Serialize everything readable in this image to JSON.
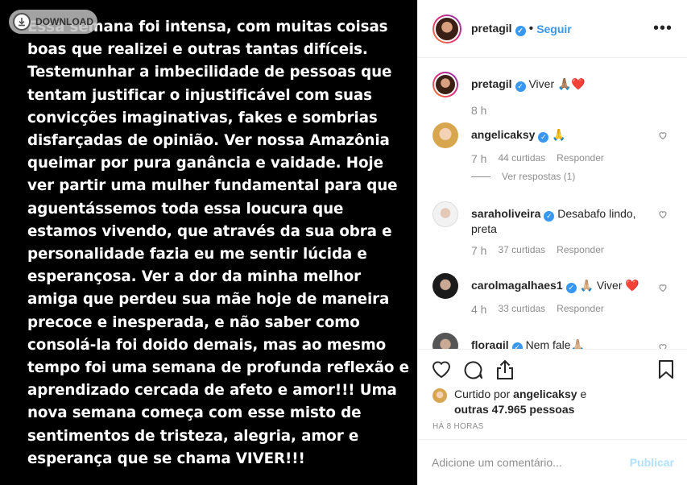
{
  "post": {
    "text": "Essa semana foi intensa, com muitas coisas boas que realizei e outras tantas difíceis. Testemunhar a imbecilidade de pessoas que tentam justificar o injustificável com suas convicções imaginativas, fakes e sombrias disfarçadas de opinião. Ver nossa Amazônia queimar por pura ganância e vaidade. Hoje ver partir uma mulher fundamental para que aguentássemos toda essa loucura que estamos vivendo, que através da sua obra e personalidade fazia eu me sentir lúcida e esperançosa. Ver a dor da minha melhor amiga que perdeu sua mãe hoje de maneira precoce e inesperada, e não saber como consolá-la foi doido demais, mas ao mesmo tempo foi uma semana de profunda reflexão e aprendizado cercada de afeto e amor!!! Uma nova semana começa com esse misto de sentimentos de tristeza, alegria, amor e esperança que se chama VIVER!!!"
  },
  "download": {
    "label": "DOWNLOAD"
  },
  "header": {
    "username": "pretagil",
    "separator": "•",
    "follow_label": "Seguir",
    "more_label": "•••"
  },
  "caption": {
    "username": "pretagil",
    "text": "Viver 🙏🏽❤️",
    "time": "8 h"
  },
  "comments": [
    {
      "username": "angelicaksy",
      "text": "🙏",
      "time": "7 h",
      "likes": "44 curtidas",
      "reply_label": "Responder",
      "view_replies": "Ver respostas (1)"
    },
    {
      "username": "saraholiveira",
      "text": "Desabafo lindo, preta",
      "time": "7 h",
      "likes": "37 curtidas",
      "reply_label": "Responder"
    },
    {
      "username": "carolmagalhaes1",
      "text": "🙏🏼 Viver ❤️",
      "time": "4 h",
      "likes": "33 curtidas",
      "reply_label": "Responder"
    },
    {
      "username": "floragil",
      "text": "Nem fale🙏🏼"
    }
  ],
  "likes": {
    "prefix": "Curtido por",
    "user": "angelicaksy",
    "middle": "e",
    "others": "outras 47.965 pessoas"
  },
  "time_ago": "HÁ 8 HORAS",
  "comment_box": {
    "placeholder": "Adicione um comentário...",
    "publish_label": "Publicar"
  },
  "icons": {
    "heart": "heart-icon",
    "comment": "comment-icon",
    "share": "share-icon",
    "bookmark": "bookmark-icon",
    "verified": "verified-icon"
  },
  "colors": {
    "accent": "#3897f0",
    "publish_disabled": "#b2dffc",
    "muted": "#8e8e8e",
    "text": "#262626"
  }
}
